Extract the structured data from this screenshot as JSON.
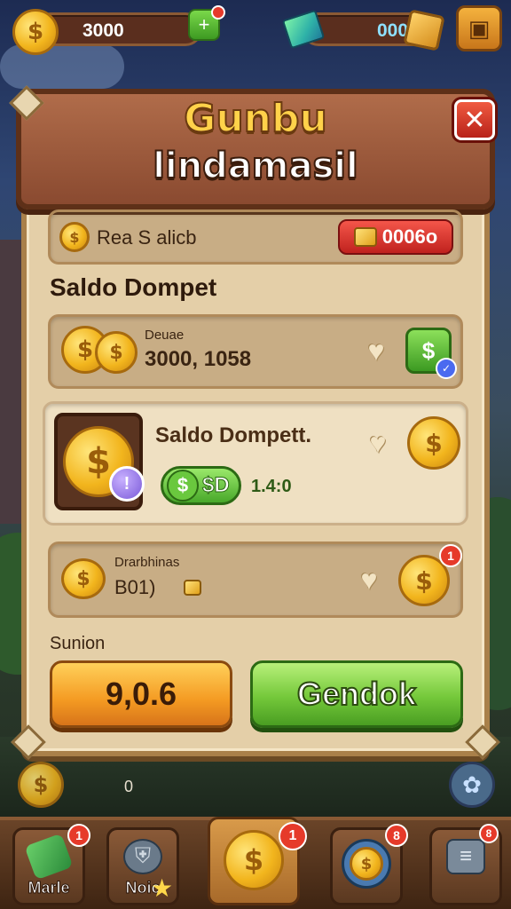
{
  "top_bar": {
    "coin_value": "3000",
    "gem_value": "000",
    "coin_icon": "$",
    "plus_icon": "+",
    "shop_icon": "shop-box-icon"
  },
  "panel": {
    "title_line_1": "Gunbu",
    "title_line_2": "lindamasil",
    "close_label": "✕",
    "top_row": {
      "label": "Rea S alicb",
      "badge_value": "0006o"
    },
    "section_title": "Saldo Dompet",
    "row_1": {
      "caption": "Deuae",
      "value": "3000, 1058"
    },
    "row_2": {
      "title": "Saldo Dompett.",
      "pill_text": "$D",
      "pill_value": "1.4:0",
      "badge_icon": "!"
    },
    "row_3": {
      "caption": "Drarbhinas",
      "value": "B01)"
    },
    "sub_label": "Sunion",
    "btn_left_label": "9,0.6",
    "btn_right_label": "Gendok"
  },
  "nav": {
    "items": [
      {
        "label": "Marle",
        "badge": "1",
        "icon": "cash-icon"
      },
      {
        "label": "Noic",
        "badge": "",
        "icon": "helmet-icon"
      },
      {
        "label": "",
        "badge": "1",
        "icon": "coin-icon"
      },
      {
        "label": "",
        "badge": "8",
        "icon": "magnifier-coin-icon"
      },
      {
        "label": "",
        "badge": "8",
        "icon": "list-icon"
      }
    ],
    "center_mark": "0"
  },
  "colors": {
    "panel_bg": "#e4cfa8",
    "header_bg": "#9a5a3a",
    "green_button": "#74c83a",
    "orange_button": "#f49a22",
    "close_red": "#d8321e"
  }
}
